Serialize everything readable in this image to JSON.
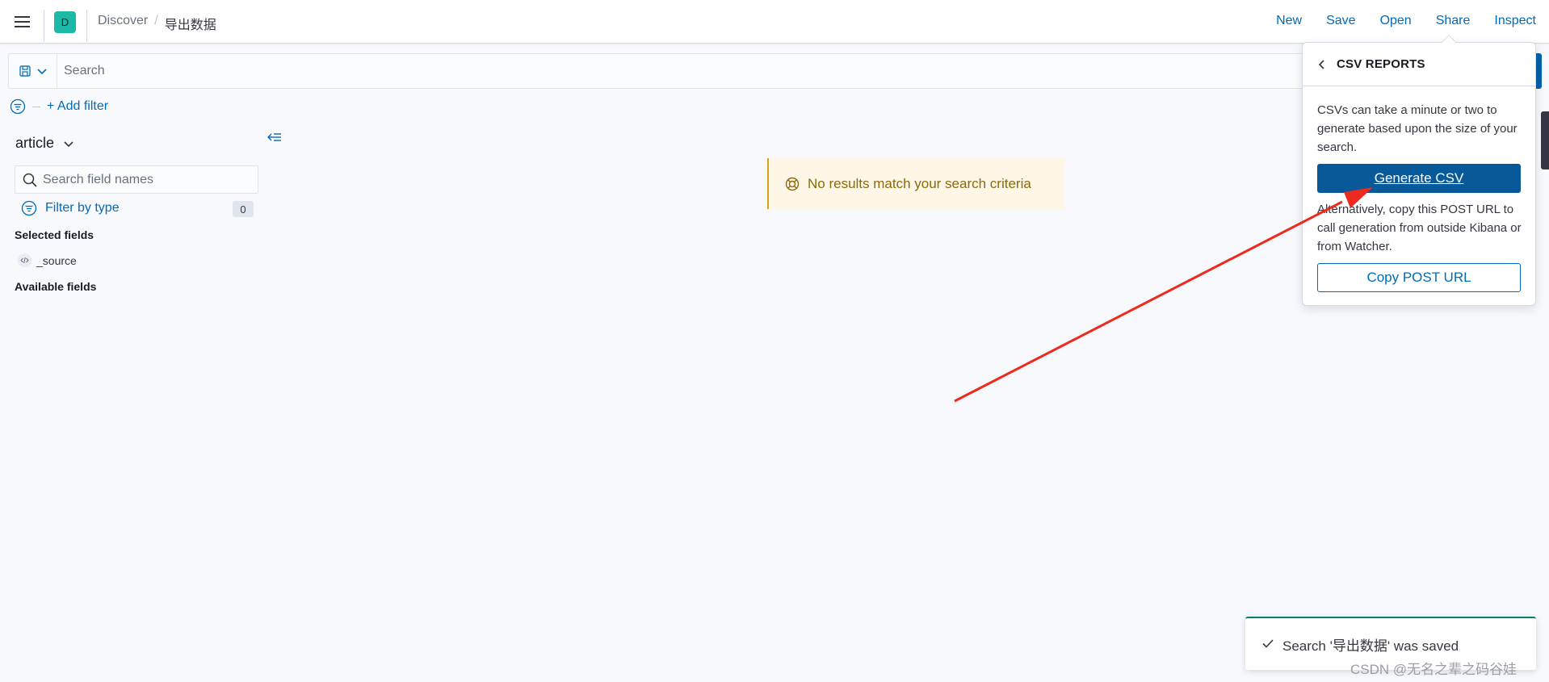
{
  "header": {
    "space_initial": "D",
    "breadcrumbs": [
      "Discover",
      "导出数据"
    ],
    "links": [
      "New",
      "Save",
      "Open",
      "Share",
      "Inspect"
    ]
  },
  "query_bar": {
    "search_placeholder": "Search",
    "add_filter_label": "+ Add filter"
  },
  "sidebar": {
    "index_pattern": "article",
    "field_search_placeholder": "Search field names",
    "filter_by_type_label": "Filter by type",
    "filter_count": "0",
    "selected_fields_title": "Selected fields",
    "selected_fields": [
      "_source"
    ],
    "available_fields_title": "Available fields"
  },
  "main": {
    "no_results_text": "No results match your search criteria"
  },
  "popover": {
    "title": "CSV REPORTS",
    "description": "CSVs can take a minute or two to generate based upon the size of your search.",
    "generate_button": "Generate CSV",
    "alt_text": "Alternatively, copy this POST URL to call generation from outside Kibana or from Watcher.",
    "copy_button": "Copy POST URL"
  },
  "toast": {
    "message": "Search '导出数据' was saved"
  },
  "watermark": "CSDN @无名之辈之码谷娃",
  "colors": {
    "link": "#006bb8",
    "primary_button": "#07599a",
    "space_avatar": "#1bb9a6",
    "callout_bg": "#fef6e6",
    "annotation_arrow": "#ee2a1f"
  }
}
